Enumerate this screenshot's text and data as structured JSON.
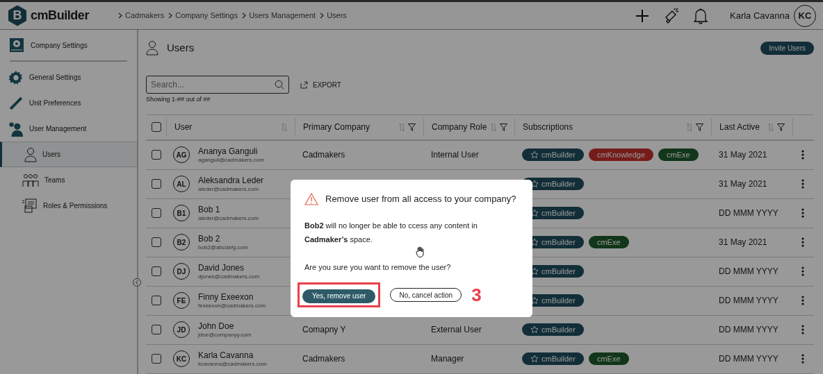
{
  "header": {
    "logo_letter": "B",
    "logo_text": "cmBuilder",
    "breadcrumbs": [
      "Cadmakers",
      "Company Settings",
      "Users Management",
      "Users"
    ],
    "user_name": "Karla Cavanna",
    "avatar_initials": "KC"
  },
  "sidebar": {
    "title": "Company Settings",
    "items": [
      {
        "label": "General Settings",
        "kind": "gear",
        "selected": false
      },
      {
        "label": "Unit Preferences",
        "kind": "ruler",
        "selected": false
      },
      {
        "label": "User Management",
        "kind": "person",
        "selected": false,
        "children": [
          {
            "label": "Users",
            "kind": "user",
            "selected": true
          },
          {
            "label": "Teams",
            "kind": "team",
            "selected": false
          },
          {
            "label": "Roles & Permissions",
            "kind": "roles",
            "selected": false
          }
        ]
      }
    ]
  },
  "page": {
    "title": "Users",
    "invite_button": "Invite Users",
    "search_placeholder": "Search...",
    "export_label": "EXPORT",
    "showing_text": "Showing 1-## out of ##"
  },
  "table": {
    "header_checked": false,
    "columns": [
      {
        "label": "User",
        "sortable": true,
        "filterable": false
      },
      {
        "label": "Primary Company",
        "sortable": true,
        "filterable": true
      },
      {
        "label": "Company Role",
        "sortable": true,
        "filterable": true
      },
      {
        "label": "Subscriptions",
        "sortable": true,
        "filterable": true
      },
      {
        "label": "Last Active",
        "sortable": true,
        "filterable": true
      }
    ],
    "rows": [
      {
        "checked": false,
        "initials": "AG",
        "name": "Ananya Ganguli",
        "email": "aganguli@cadmakers.com",
        "primary_company": "Cadmakers",
        "company_role": "Internal User",
        "subscriptions": [
          {
            "label": "cmBuilder",
            "kind": "builder"
          },
          {
            "label": "cmKnowledge",
            "kind": "knowledge"
          },
          {
            "label": "cmExe",
            "kind": "exe"
          }
        ],
        "last_active": "31 May 2021"
      },
      {
        "checked": false,
        "initials": "AL",
        "name": "Aleksandra Leder",
        "email": "aleder@cadmakers.com",
        "subscriptions": [
          {
            "label": "cmBuilder",
            "kind": "builder"
          }
        ],
        "last_active": "31 May 2021"
      },
      {
        "checked": false,
        "initials": "B1",
        "name": "Bob 1",
        "email": "aleder@cadmakers.com",
        "subscriptions": [
          {
            "label": "cmBuilder",
            "kind": "builder"
          }
        ],
        "last_active": "DD MMM YYYY"
      },
      {
        "checked": false,
        "initials": "B2",
        "name": "Bob 2",
        "email": "bob2@abcdefg.com",
        "subscriptions": [
          {
            "label": "cmBuilder",
            "kind": "builder"
          },
          {
            "label": "cmExe",
            "kind": "exe"
          }
        ],
        "last_active": "31 May 2021"
      },
      {
        "checked": false,
        "initials": "DJ",
        "name": "David Jones",
        "email": "djones@cadmakers.com",
        "subscriptions": [
          {
            "label": "cmBuilder",
            "kind": "builder"
          }
        ],
        "last_active": "DD MMM YYYY"
      },
      {
        "checked": false,
        "initials": "FE",
        "name": "Finny Exeexon",
        "email": "fexeexon@cadmakers.com",
        "subscriptions": [
          {
            "label": "cmBuilder",
            "kind": "builder"
          }
        ],
        "last_active": "DD MMM YYYY"
      },
      {
        "checked": false,
        "initials": "JD",
        "name": "John Doe",
        "email": "jdoe@companyy.com",
        "primary_company": "Comapny Y",
        "company_role": "External User",
        "subscriptions": [
          {
            "label": "cmBuilder",
            "kind": "builder"
          }
        ],
        "last_active": "DD MMM YYYY"
      },
      {
        "checked": false,
        "initials": "KC",
        "name": "Karla Cavanna",
        "email": "kcavanna@cadmakers.com",
        "primary_company": "Cadmakers",
        "company_role": "Manager",
        "subscriptions": [
          {
            "label": "cmBuilder",
            "kind": "builder"
          },
          {
            "label": "cmExe",
            "kind": "exe"
          }
        ],
        "last_active": "DD MMM YYYY"
      }
    ]
  },
  "dialog": {
    "title": "Remove user from all access to your company?",
    "message": "**Bob2** will no longer be able to ccess any content in **Cadmaker’s** space.",
    "question": "Are you sure you want to remove the user?",
    "confirm_button": "Yes, remove user",
    "cancel_button": "No, cancel action",
    "step_number": "3"
  }
}
